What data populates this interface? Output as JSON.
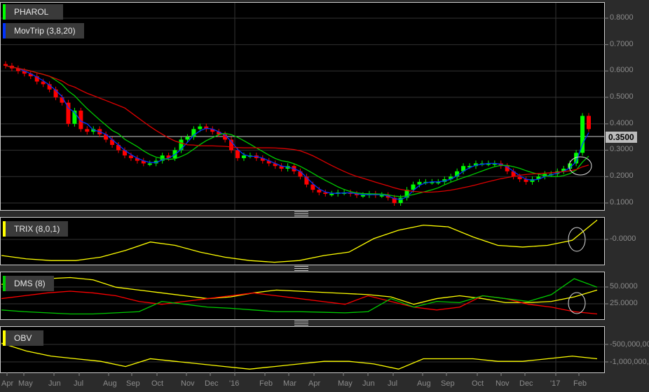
{
  "symbol": "PHAROL",
  "current_price": "0.3500",
  "panels": {
    "main": {
      "legend": [
        {
          "label": "PHAROL",
          "color": "#00ff00"
        },
        {
          "label": "MovTrip (3,8,20)",
          "color": "#0033ff"
        }
      ],
      "axis": [
        "0.8000",
        "0.7000",
        "0.6000",
        "0.5000",
        "0.4000",
        "0.3000",
        "0.2000",
        "0.1000"
      ]
    },
    "trix": {
      "label": "TRIX (8,0,1)",
      "color": "#ffff00",
      "axis": [
        "-0.0000"
      ]
    },
    "dms": {
      "label": "DMS (8)",
      "color": "#00cc00",
      "axis": [
        "50.0000",
        "25.0000"
      ]
    },
    "obv": {
      "label": "OBV",
      "color": "#ffff00",
      "axis": [
        "-500,000,000",
        "-1,000,000,000"
      ]
    }
  },
  "x_labels": [
    "Apr",
    "May",
    "Jun",
    "Jul",
    "Aug",
    "Sep",
    "Oct",
    "Nov",
    "Dec",
    "'16",
    "Feb",
    "Mar",
    "Apr",
    "May",
    "Jun",
    "Jul",
    "Aug",
    "Sep",
    "Oct",
    "Nov",
    "Dec",
    "'17",
    "Feb"
  ],
  "chart_data": {
    "type": "candlestick",
    "yrange": [
      0.07,
      0.85
    ],
    "closes": [
      0.62,
      0.61,
      0.6,
      0.59,
      0.58,
      0.56,
      0.55,
      0.53,
      0.5,
      0.48,
      0.4,
      0.45,
      0.38,
      0.37,
      0.38,
      0.36,
      0.34,
      0.32,
      0.3,
      0.28,
      0.27,
      0.26,
      0.25,
      0.25,
      0.26,
      0.28,
      0.27,
      0.3,
      0.34,
      0.35,
      0.38,
      0.39,
      0.38,
      0.37,
      0.36,
      0.34,
      0.3,
      0.27,
      0.28,
      0.28,
      0.27,
      0.26,
      0.25,
      0.24,
      0.23,
      0.24,
      0.22,
      0.2,
      0.17,
      0.15,
      0.14,
      0.135,
      0.135,
      0.14,
      0.14,
      0.135,
      0.13,
      0.13,
      0.135,
      0.13,
      0.13,
      0.12,
      0.1,
      0.12,
      0.15,
      0.17,
      0.18,
      0.18,
      0.18,
      0.18,
      0.19,
      0.2,
      0.22,
      0.24,
      0.24,
      0.25,
      0.25,
      0.25,
      0.25,
      0.24,
      0.22,
      0.2,
      0.19,
      0.18,
      0.19,
      0.2,
      0.21,
      0.21,
      0.22,
      0.23,
      0.25,
      0.29,
      0.43,
      0.38
    ],
    "trix": [
      -0.6,
      -0.8,
      -0.9,
      -0.9,
      -0.7,
      -0.3,
      0.2,
      0.0,
      -0.4,
      -0.7,
      -0.9,
      -1.0,
      -0.9,
      -0.6,
      -0.4,
      0.4,
      0.9,
      1.2,
      1.1,
      0.5,
      0.0,
      -0.1,
      0.0,
      0.3,
      1.5
    ],
    "dms_plus": [
      15,
      12,
      10,
      8,
      8,
      10,
      12,
      30,
      25,
      20,
      18,
      15,
      12,
      12,
      11,
      10,
      12,
      35,
      20,
      30,
      28,
      40,
      35,
      30,
      42,
      70,
      55
    ],
    "dms_minus": [
      35,
      40,
      45,
      48,
      45,
      40,
      30,
      25,
      30,
      35,
      40,
      45,
      40,
      35,
      30,
      25,
      40,
      30,
      20,
      15,
      20,
      40,
      35,
      25,
      20,
      12,
      8
    ],
    "adx": [
      60,
      65,
      70,
      72,
      68,
      55,
      50,
      45,
      40,
      35,
      38,
      45,
      50,
      48,
      46,
      44,
      42,
      38,
      25,
      35,
      40,
      35,
      28,
      28,
      30,
      38,
      50
    ],
    "obv": [
      -700,
      -850,
      -950,
      -1000,
      -1050,
      -1150,
      -1000,
      -1050,
      -1100,
      -1150,
      -1200,
      -1150,
      -1100,
      -1050,
      -1050,
      -1100,
      -1200,
      -1000,
      -1000,
      -1000,
      -1050,
      -1050,
      -1000,
      -950,
      -1000
    ]
  }
}
